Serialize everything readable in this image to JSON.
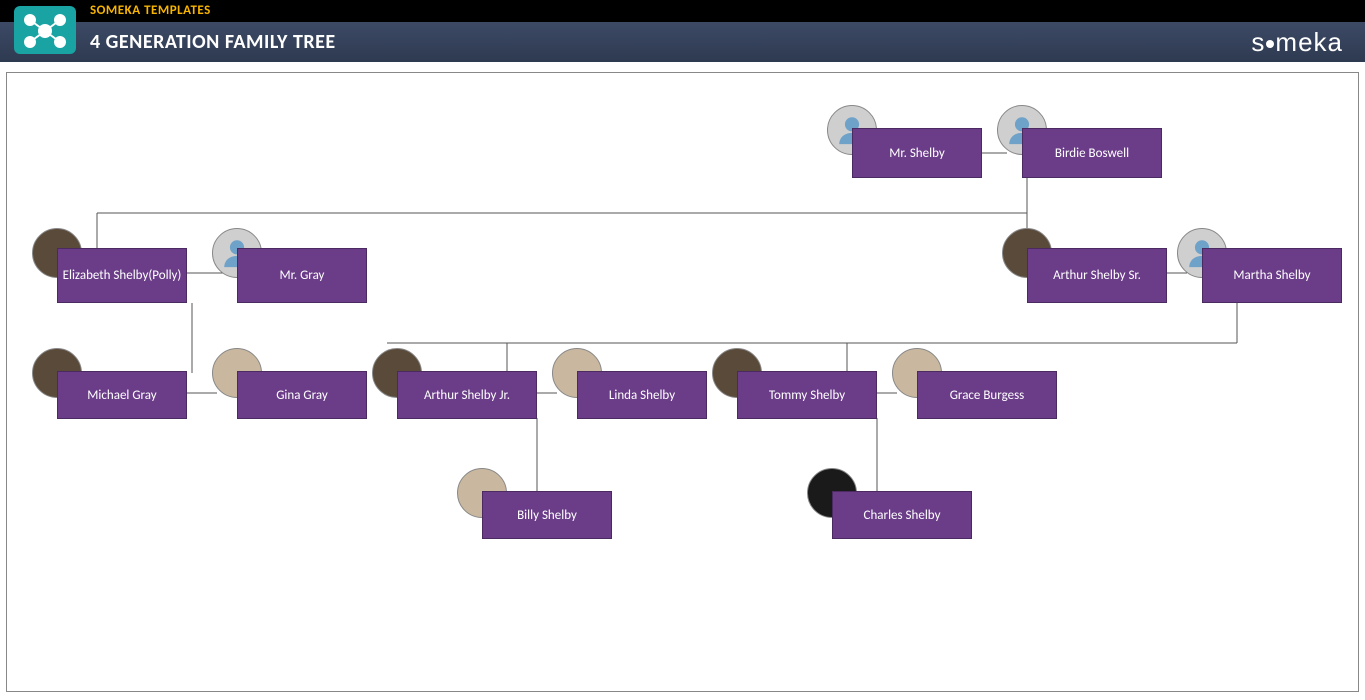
{
  "header": {
    "brand_line": "SOMEKA TEMPLATES",
    "title": "4 GENERATION FAMILY TREE",
    "logo_text": "someka"
  },
  "nodes": {
    "mr_shelby": "Mr. Shelby",
    "birdie": "Birdie Boswell",
    "polly": "Elizabeth Shelby(Polly)",
    "mr_gray": "Mr. Gray",
    "arthur_sr": "Arthur Shelby Sr.",
    "martha": "Martha Shelby",
    "michael": "Michael Gray",
    "gina": "Gina Gray",
    "arthur_jr": "Arthur Shelby Jr.",
    "linda": "Linda Shelby",
    "tommy": "Tommy Shelby",
    "grace": "Grace Burgess",
    "billy": "Billy Shelby",
    "charles": "Charles Shelby"
  },
  "chart_data": {
    "type": "tree",
    "title": "4 Generation Family Tree",
    "generations": [
      {
        "level": 1,
        "couples": [
          {
            "left": "Mr. Shelby",
            "right": "Birdie Boswell",
            "children": [
              "Arthur Shelby Sr."
            ]
          }
        ]
      },
      {
        "level": 2,
        "couples": [
          {
            "left": "Elizabeth Shelby(Polly)",
            "right": "Mr. Gray",
            "children": [
              "Michael Gray"
            ]
          },
          {
            "left": "Arthur Shelby Sr.",
            "right": "Martha Shelby",
            "children": [
              "Arthur Shelby Jr.",
              "Tommy Shelby"
            ]
          }
        ]
      },
      {
        "level": 3,
        "couples": [
          {
            "left": "Michael Gray",
            "right": "Gina Gray",
            "children": []
          },
          {
            "left": "Arthur Shelby Jr.",
            "right": "Linda Shelby",
            "children": [
              "Billy Shelby"
            ]
          },
          {
            "left": "Tommy Shelby",
            "right": "Grace Burgess",
            "children": [
              "Charles Shelby"
            ]
          }
        ]
      },
      {
        "level": 4,
        "people": [
          "Billy Shelby",
          "Charles Shelby"
        ]
      }
    ]
  }
}
